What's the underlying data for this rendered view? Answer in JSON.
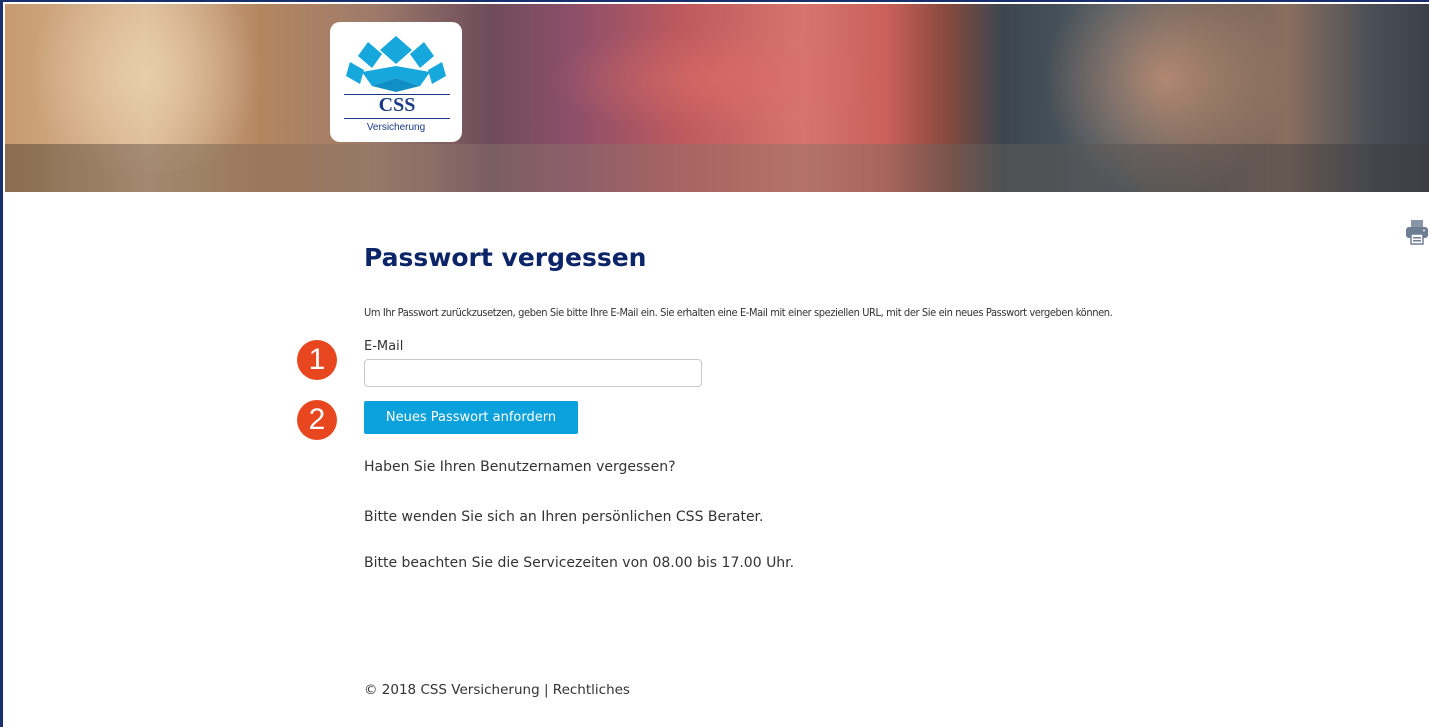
{
  "brand": {
    "logo_text": "CSS",
    "logo_subtext": "Versicherung",
    "logo_color": "#1a3a86",
    "logo_accent_color": "#16a7dd"
  },
  "header": {
    "print_icon": "printer-icon"
  },
  "main": {
    "title": "Passwort vergessen",
    "intro": "Um Ihr Passwort zurückzusetzen, geben Sie bitte Ihre E-Mail ein. Sie erhalten eine E-Mail mit einer speziellen URL, mit der Sie ein neues Passwort vergeben können.",
    "email_label": "E-Mail",
    "email_value": "",
    "submit_label": "Neues Passwort anfordern",
    "username_question": "Haben Sie Ihren Benutzernamen vergessen?",
    "contact_advisor": "Bitte wenden Sie sich an Ihren persönlichen CSS Berater.",
    "service_hours": "Bitte beachten Sie die Servicezeiten von 08.00 bis 17.00 Uhr."
  },
  "footer": {
    "copyright": "© 2018 CSS Versicherung",
    "separator": "|",
    "legal_link": "Rechtliches"
  },
  "annotations": {
    "step_1": "1",
    "step_2": "2",
    "color": "#e8461f"
  },
  "colors": {
    "title": "#0c2468",
    "button": "#0aa1dc",
    "frame_border": "#1a2f6e"
  }
}
